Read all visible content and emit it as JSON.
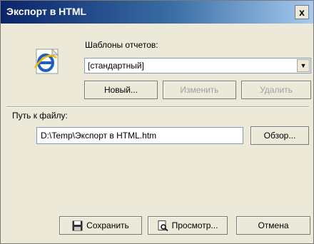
{
  "window": {
    "title": "Экспорт в HTML",
    "close_label": "x"
  },
  "icon": {
    "name": "ie-icon"
  },
  "templates": {
    "label": "Шаблоны отчетов:",
    "selected": "[стандартный]",
    "buttons": {
      "new": "Новый...",
      "edit": "Изменить",
      "delete": "Удалить"
    }
  },
  "path": {
    "label": "Путь к файлу:",
    "value": "D:\\Temp\\Экспорт в HTML.htm",
    "browse": "Обзор..."
  },
  "footer": {
    "save": "Сохранить",
    "preview": "Просмотр...",
    "cancel": "Отмена"
  },
  "colors": {
    "title_bar": "#0a246a",
    "dialog_bg": "#ece9d8"
  }
}
